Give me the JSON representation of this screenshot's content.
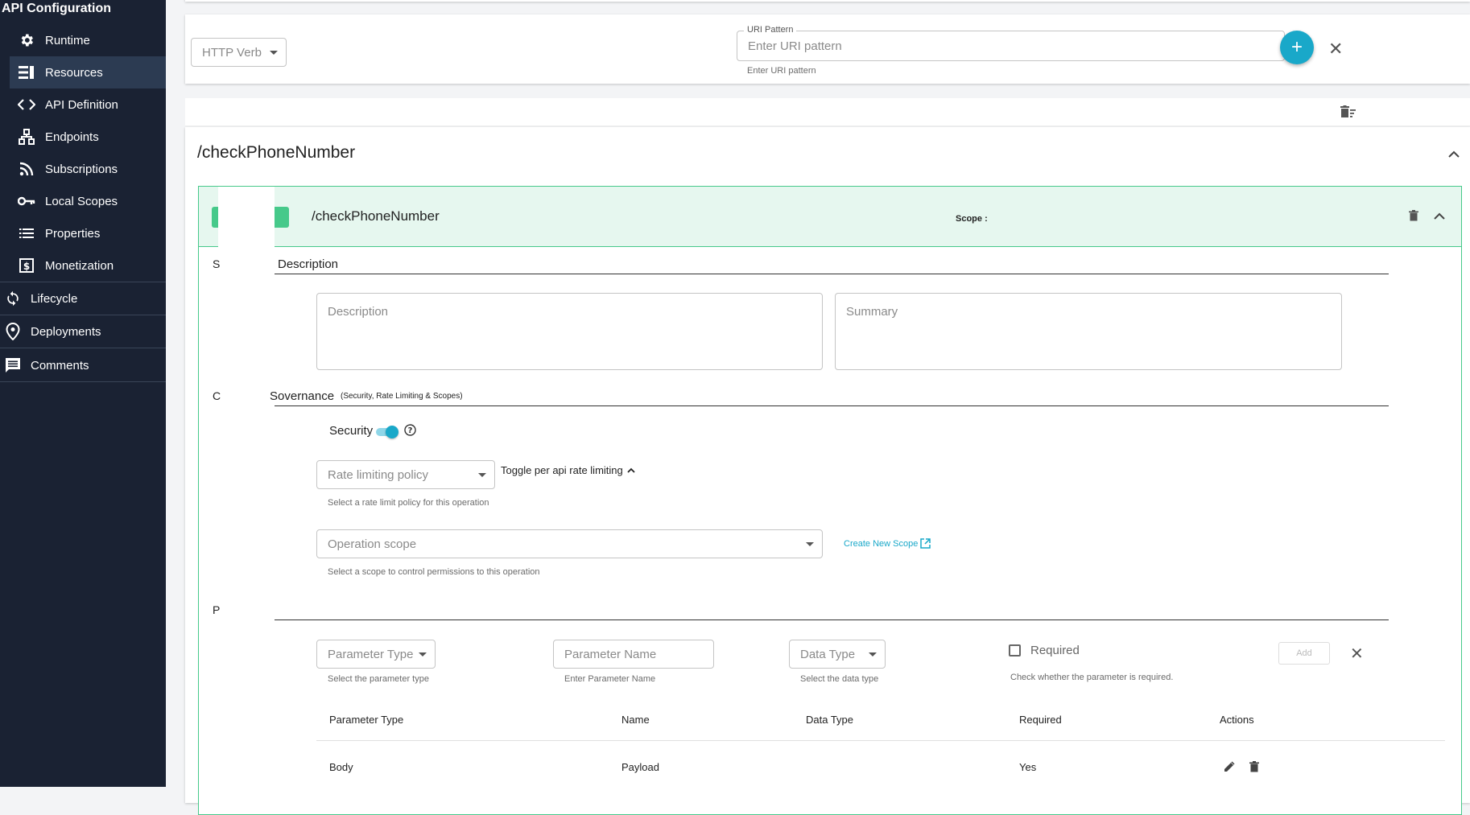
{
  "sidebar": {
    "title": "API Configuration",
    "items": [
      {
        "label": "Runtime",
        "icon": "gear-icon"
      },
      {
        "label": "Resources",
        "icon": "resources-icon",
        "active": true
      },
      {
        "label": "API Definition",
        "icon": "code-icon"
      },
      {
        "label": "Endpoints",
        "icon": "endpoints-icon"
      },
      {
        "label": "Subscriptions",
        "icon": "rss-icon"
      },
      {
        "label": "Local Scopes",
        "icon": "key-icon"
      },
      {
        "label": "Properties",
        "icon": "list-icon"
      },
      {
        "label": "Monetization",
        "icon": "dollar-icon"
      }
    ],
    "top_items": [
      {
        "label": "Lifecycle",
        "icon": "refresh-icon"
      },
      {
        "label": "Deployments",
        "icon": "location-icon"
      },
      {
        "label": "Comments",
        "icon": "comment-icon"
      }
    ]
  },
  "add_resource": {
    "http_verb_placeholder": "HTTP Verb",
    "uri_label": "URI Pattern",
    "uri_placeholder": "Enter URI pattern",
    "uri_helper": "Enter URI pattern",
    "add_symbol": "+",
    "close_symbol": "✕"
  },
  "resource_group": {
    "title": "/checkPhoneNumber",
    "operation": {
      "path": "/checkPhoneNumber",
      "scope_label": "Scope :",
      "sections": {
        "description": {
          "prefix": "S",
          "label": "Description"
        },
        "governance": {
          "prefix": "C",
          "label": "Governance",
          "label_partial": "Sovernance",
          "sub": "(Security, Rate Limiting & Scopes)"
        },
        "parameters": {
          "prefix": "P"
        }
      },
      "description_placeholder": "Description",
      "summary_placeholder": "Summary",
      "security_label": "Security",
      "security_enabled": true,
      "rate_limit_placeholder": "Rate limiting policy",
      "rate_limit_helper": "Select a rate limit policy for this operation",
      "toggle_rate_limit_label": "Toggle per api rate limiting",
      "operation_scope_placeholder": "Operation scope",
      "operation_scope_helper": "Select a scope to control permissions to this operation",
      "create_scope_link": "Create New Scope",
      "parameter_form": {
        "type_placeholder": "Parameter Type",
        "type_helper": "Select the parameter type",
        "name_placeholder": "Parameter Name",
        "name_helper": "Enter Parameter Name",
        "data_type_placeholder": "Data Type",
        "data_type_helper": "Select the data type",
        "required_label": "Required",
        "required_helper": "Check whether the parameter is required.",
        "add_label": "Add"
      },
      "parameters_table": {
        "headers": [
          "Parameter Type",
          "Name",
          "Data Type",
          "Required",
          "Actions"
        ],
        "rows": [
          {
            "type": "Body",
            "name": "Payload",
            "data_type": "",
            "required": "Yes"
          }
        ]
      }
    }
  },
  "colors": {
    "sidebar_bg": "#1a2233",
    "accent": "#19a8c9",
    "operation_bg": "#e6f7ef",
    "operation_border": "#46c98a",
    "verb_badge": "#46c98a"
  }
}
